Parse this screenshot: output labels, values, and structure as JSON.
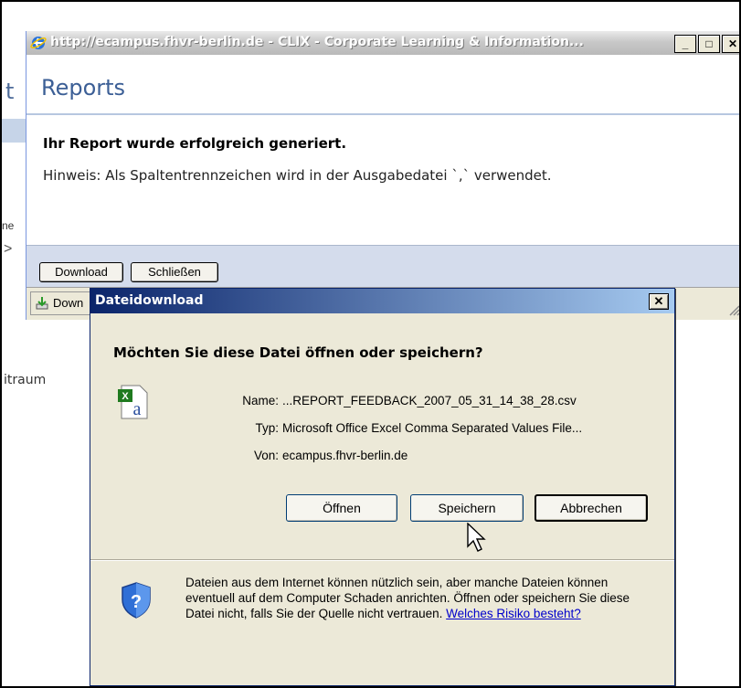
{
  "background": {
    "heading_fragment": "t",
    "text_fragment_1": "ne",
    "arrow": ">",
    "text_fragment_2": "itraum"
  },
  "ie_window": {
    "title": "http://ecampus.fhvr-berlin.de - CLIX - Corporate Learning & Information...",
    "controls": {
      "minimize": "_",
      "maximize": "□",
      "close": "✕"
    },
    "heading": "Reports",
    "success_message": "Ihr Report wurde erfolgreich generiert.",
    "note": "Hinweis: Als Spaltentrennzeichen wird in der Ausgabedatei `,` verwendet.",
    "download_button": "Download",
    "close_button": "Schließen",
    "status_download": "Down"
  },
  "dialog": {
    "title": "Dateidownload",
    "close_glyph": "✕",
    "question": "Möchten Sie diese Datei öffnen oder speichern?",
    "file": {
      "name_label": "Name:",
      "name_value": "...REPORT_FEEDBACK_2007_05_31_14_38_28.csv",
      "type_label": "Typ:",
      "type_value": "Microsoft Office Excel Comma Separated Values File...",
      "from_label": "Von:",
      "from_value": "ecampus.fhvr-berlin.de"
    },
    "buttons": {
      "open": "Öffnen",
      "save": "Speichern",
      "cancel": "Abbrechen"
    },
    "warning_text": "Dateien aus dem Internet können nützlich sein, aber manche Dateien können eventuell auf dem Computer Schaden anrichten. Öffnen oder speichern Sie diese Datei nicht, falls Sie der Quelle nicht vertrauen.",
    "warning_link": "Welches Risiko besteht?"
  }
}
